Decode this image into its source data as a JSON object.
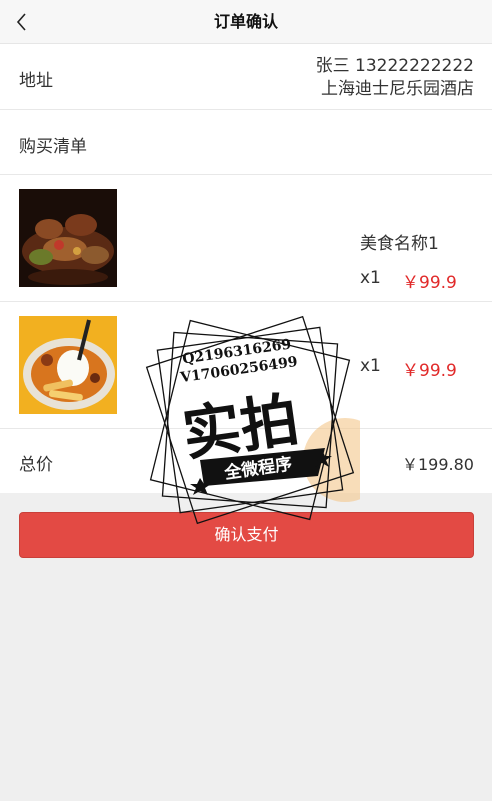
{
  "nav": {
    "title": "订单确认",
    "back_icon": "chevron-left-icon"
  },
  "address": {
    "label": "地址",
    "name_phone": "张三 13222222222",
    "location": "上海迪士尼乐园酒店"
  },
  "list_header": {
    "label": "购买清单"
  },
  "items": [
    {
      "name": "美食名称1",
      "qty": "x1",
      "price": "￥99.9"
    },
    {
      "name": "",
      "qty": "x1",
      "price": "￥99.9"
    }
  ],
  "total": {
    "label": "总价",
    "value": "￥199.80"
  },
  "actions": {
    "pay_label": "确认支付"
  },
  "watermark": {
    "line1": "Q2196316269",
    "line2": "V17060256499",
    "big": "实拍",
    "banner": "全微程序"
  },
  "colors": {
    "accent": "#e34a44",
    "price": "#e12a2a",
    "background": "#efefef"
  }
}
